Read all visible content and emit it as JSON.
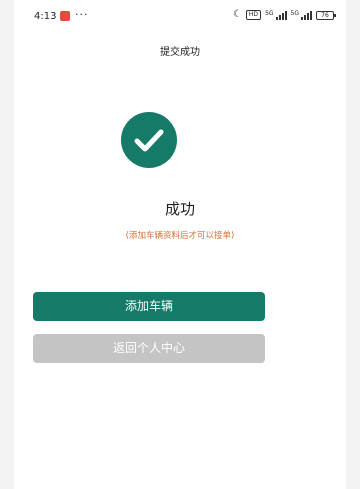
{
  "status_bar": {
    "time": "4:13",
    "dots": "···",
    "hd_label": "HD",
    "network_label_1": "5G",
    "network_label_2": "5G",
    "battery": "76"
  },
  "header": {
    "title": "提交成功"
  },
  "result": {
    "icon": "check-circle-icon",
    "title": "成功",
    "hint": "(添加车辆资料后才可以接单)"
  },
  "actions": {
    "primary_label": "添加车辆",
    "secondary_label": "返回个人中心"
  },
  "colors": {
    "accent": "#157a68",
    "hint": "#d4703a",
    "disabled": "#c4c4c4"
  }
}
